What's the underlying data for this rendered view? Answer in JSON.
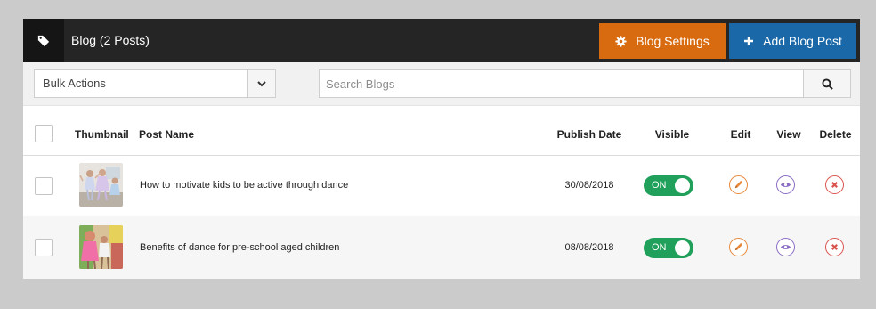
{
  "header": {
    "title": "Blog (2 Posts)",
    "settings_label": "Blog Settings",
    "add_label": "Add Blog Post",
    "settings_color": "#d86b10",
    "add_color": "#1a68a7"
  },
  "toolbar": {
    "bulk_selected": "Bulk Actions",
    "search_placeholder": "Search Blogs"
  },
  "table": {
    "columns": [
      "Thumbnail",
      "Post Name",
      "Publish Date",
      "Visible",
      "Edit",
      "View",
      "Delete"
    ],
    "rows": [
      {
        "post_name": "How to motivate kids to be active through dance",
        "publish_date": "30/08/2018",
        "visible": "ON"
      },
      {
        "post_name": "Benefits of dance for pre-school aged children",
        "publish_date": "08/08/2018",
        "visible": "ON"
      }
    ]
  },
  "icons": {
    "tag": "tag-icon",
    "settings": "gear-icon",
    "add": "plus-icon",
    "caret": "chevron-down-icon",
    "search": "search-icon",
    "edit": "pencil-icon",
    "view": "eye-icon",
    "delete": "close-icon"
  }
}
